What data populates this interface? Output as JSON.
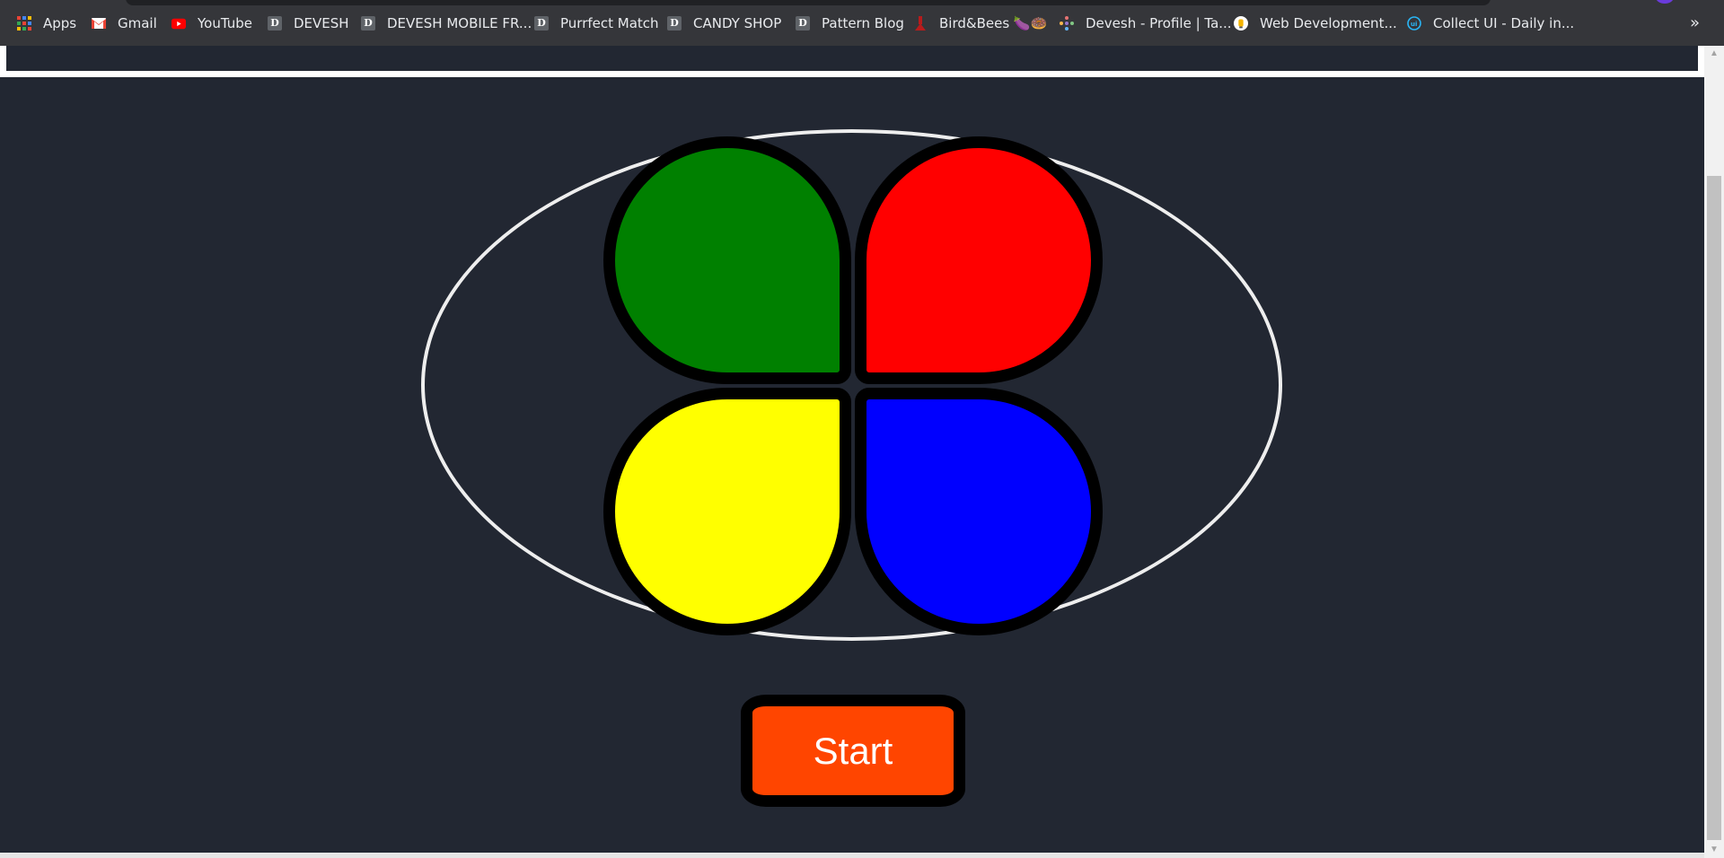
{
  "bookmarks_bar": {
    "items": [
      {
        "label": "Apps",
        "icon": "apps-grid-icon"
      },
      {
        "label": "Gmail",
        "icon": "gmail-icon"
      },
      {
        "label": "YouTube",
        "icon": "youtube-icon"
      },
      {
        "label": "DEVESH",
        "icon": "d-favicon"
      },
      {
        "label": "DEVESH MOBILE FR...",
        "icon": "d-favicon"
      },
      {
        "label": "Purrfect Match",
        "icon": "d-favicon"
      },
      {
        "label": "CANDY SHOP",
        "icon": "d-favicon"
      },
      {
        "label": "Pattern Blog",
        "icon": "d-favicon"
      },
      {
        "label": "Bird&Bees 🍆🍩",
        "icon": "birdbees-icon"
      },
      {
        "label": "Devesh - Profile | Ta...",
        "icon": "profile-icon"
      },
      {
        "label": "Web Development...",
        "icon": "webdev-icon"
      },
      {
        "label": "Collect UI - Daily in...",
        "icon": "collectui-icon"
      }
    ],
    "overflow_label": "»",
    "favicon_letter": "D"
  },
  "game": {
    "pads": [
      {
        "name": "green",
        "color": "#008000"
      },
      {
        "name": "red",
        "color": "#ff0000"
      },
      {
        "name": "yellow",
        "color": "#ffff00"
      },
      {
        "name": "blue",
        "color": "#0000ff"
      }
    ],
    "start_label": "Start",
    "start_color": "#ff4500",
    "background_color": "#222732"
  }
}
